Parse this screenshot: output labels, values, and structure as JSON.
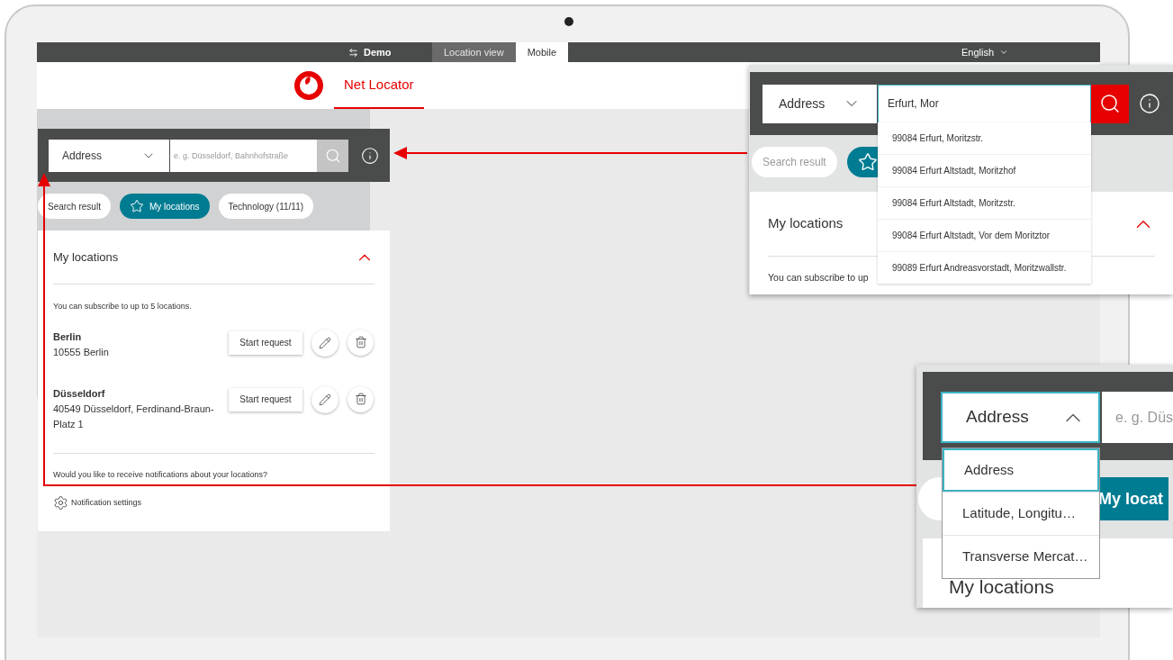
{
  "top_bar": {
    "mode_label": "Demo",
    "tabs": [
      {
        "label": "Location view",
        "selected": false
      },
      {
        "label": "Mobile",
        "selected": true
      }
    ],
    "language": "English"
  },
  "header": {
    "app_title": "Net Locator"
  },
  "search": {
    "mode": "Address",
    "placeholder": "e. g. Düsseldorf, Bahnhofstraße"
  },
  "filter_chips": [
    {
      "label": "Search result",
      "selected": false
    },
    {
      "label": "My locations",
      "selected": true
    },
    {
      "label": "Technology (11/11)",
      "selected": false
    }
  ],
  "locations_panel": {
    "title": "My locations",
    "expanded": true,
    "intro": "You can subscribe to up to 5 locations.",
    "locations": [
      {
        "name": "Berlin",
        "address": "10555 Berlin",
        "button": "Start request"
      },
      {
        "name": "Düsseldorf",
        "address": "40549 Düsseldorf, Ferdinand-Braun-Platz 1",
        "button": "Start request"
      }
    ],
    "notification_question": "Would you like to receive notifications about your locations?",
    "notification_settings": "Notification settings"
  },
  "callout_search": {
    "mode": "Address",
    "value": "Erfurt, Mor",
    "suggestions": [
      "99084 Erfurt, Moritzstr.",
      "99084 Erfurt Altstadt, Moritzhof",
      "99084 Erfurt Altstadt, Moritzstr.",
      "99084 Erfurt Altstadt, Vor dem Moritztor",
      "99089 Erfurt Andreasvorstadt, Moritzwallstr."
    ],
    "chips": [
      {
        "label": "Search result",
        "selected": false
      },
      {
        "selected": true
      }
    ],
    "panel_title": "My locations",
    "panel_expanded": true,
    "intro_visible": "You can subscribe to up"
  },
  "callout_mode_menu": {
    "mode": "Address",
    "expanded": true,
    "placeholder": "e. g. Düs",
    "options": [
      {
        "label": "Address",
        "selected": true
      },
      {
        "label": "Latitude, Longitu…",
        "selected": false
      },
      {
        "label": "Transverse Mercat…",
        "selected": false
      }
    ],
    "chips": [
      {
        "selected": false
      },
      {
        "label": "My locat",
        "selected": true
      }
    ],
    "panel_title": "My locations"
  }
}
